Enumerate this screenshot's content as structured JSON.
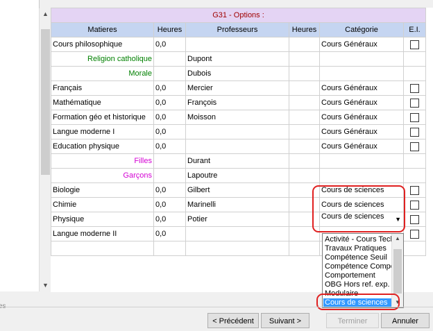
{
  "sidebar_hint": "es",
  "table": {
    "title": "G31  -  Options :",
    "headers": [
      "Matieres",
      "Heures",
      "Professeurs",
      "Heures",
      "Catégorie",
      "E.I."
    ],
    "rows": [
      {
        "matiere": "Cours philosophique",
        "heures": "0,0",
        "prof": "",
        "heures2": "",
        "categorie": "Cours Généraux",
        "check": true,
        "sub": ""
      },
      {
        "matiere": "Religion catholique",
        "heures": "",
        "prof": "Dupont",
        "heures2": "",
        "categorie": "",
        "check": false,
        "sub": "green"
      },
      {
        "matiere": "Morale",
        "heures": "",
        "prof": "Dubois",
        "heures2": "",
        "categorie": "",
        "check": false,
        "sub": "green"
      },
      {
        "matiere": "Français",
        "heures": "0,0",
        "prof": "Mercier",
        "heures2": "",
        "categorie": "Cours Généraux",
        "check": true,
        "sub": ""
      },
      {
        "matiere": "Mathématique",
        "heures": "0,0",
        "prof": "François",
        "heures2": "",
        "categorie": "Cours Généraux",
        "check": true,
        "sub": ""
      },
      {
        "matiere": "Formation géo et historique",
        "heures": "0,0",
        "prof": "Moisson",
        "heures2": "",
        "categorie": "Cours Généraux",
        "check": true,
        "sub": ""
      },
      {
        "matiere": "Langue moderne I",
        "heures": "0,0",
        "prof": "",
        "heures2": "",
        "categorie": "Cours Généraux",
        "check": true,
        "sub": ""
      },
      {
        "matiere": "Education physique",
        "heures": "0,0",
        "prof": "",
        "heures2": "",
        "categorie": "Cours Généraux",
        "check": true,
        "sub": ""
      },
      {
        "matiere": "Filles",
        "heures": "",
        "prof": "Durant",
        "heures2": "",
        "categorie": "",
        "check": false,
        "sub": "magenta"
      },
      {
        "matiere": "Garçons",
        "heures": "",
        "prof": "Lapoutre",
        "heures2": "",
        "categorie": "",
        "check": false,
        "sub": "magenta"
      },
      {
        "matiere": "Biologie",
        "heures": "0,0",
        "prof": "Gilbert",
        "heures2": "",
        "categorie": "Cours de sciences",
        "check": true,
        "sub": ""
      },
      {
        "matiere": "Chimie",
        "heures": "0,0",
        "prof": "Marinelli",
        "heures2": "",
        "categorie": "Cours de sciences",
        "check": true,
        "sub": ""
      },
      {
        "matiere": "Physique",
        "heures": "0,0",
        "prof": "Potier",
        "heures2": "",
        "categorie": "Cours de sciences",
        "check": true,
        "sub": "",
        "dropdown": true
      },
      {
        "matiere": "Langue moderne II",
        "heures": "0,0",
        "prof": "",
        "heures2": "",
        "categorie": "",
        "check": true,
        "sub": ""
      },
      {
        "matiere": "",
        "heures": "",
        "prof": "",
        "heures2": "",
        "categorie": "",
        "check": false,
        "sub": ""
      }
    ]
  },
  "dropdown_options": [
    "Activité - Cours Tech",
    "Travaux Pratiques",
    "Compétence Seuil",
    "Compétence Compo",
    "Comportement",
    "OBG Hors ref. exp.",
    "Modulaire",
    "Cours de sciences"
  ],
  "dropdown_selected_index": 7,
  "buttons": {
    "prev": "< Précédent",
    "next": "Suivant >",
    "finish": "Terminer",
    "cancel": "Annuler"
  },
  "colors": {
    "highlight_ring": "#e02020",
    "selected_option": "#3399ff",
    "header_bg": "#c5d5f1",
    "title_bg": "#e4d4f4"
  }
}
